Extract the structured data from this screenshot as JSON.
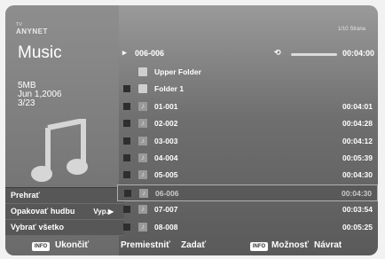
{
  "brand": {
    "line1": "TV",
    "line2": "ANYNET"
  },
  "page_indicator": "1/10 Strana",
  "left": {
    "title": "Music",
    "size": "5MB",
    "date": "Jun 1,2006",
    "index": "3/23"
  },
  "now_playing": {
    "track": "006-006",
    "time": "00:04:00"
  },
  "list": [
    {
      "type": "folder",
      "name": "Upper Folder",
      "duration": ""
    },
    {
      "type": "folder",
      "name": "Folder 1",
      "duration": ""
    },
    {
      "type": "music",
      "name": "01-001",
      "duration": "00:04:01"
    },
    {
      "type": "music",
      "name": "02-002",
      "duration": "00:04:28"
    },
    {
      "type": "music",
      "name": "03-003",
      "duration": "00:04:12"
    },
    {
      "type": "music",
      "name": "04-004",
      "duration": "00:05:39"
    },
    {
      "type": "music",
      "name": "05-005",
      "duration": "00:04:30"
    },
    {
      "type": "music",
      "name": "06-006",
      "duration": "00:04:30"
    },
    {
      "type": "music",
      "name": "07-007",
      "duration": "00:03:54"
    },
    {
      "type": "music",
      "name": "08-008",
      "duration": "00:05:25"
    }
  ],
  "menu": {
    "items": [
      {
        "label": "Prehrať",
        "option": ""
      },
      {
        "label": "Opakovať hudbu",
        "option": "Vyp.▶"
      },
      {
        "label": "Vybrať všetko",
        "option": ""
      }
    ]
  },
  "bottom": {
    "info_chip": "INFO",
    "exit_label": "Ukončiť",
    "move_label": "Premiestniť",
    "enter_label": "Zadať",
    "option_chip": "INFO",
    "option_label": "Možnosť",
    "return_label": "Návrat"
  }
}
